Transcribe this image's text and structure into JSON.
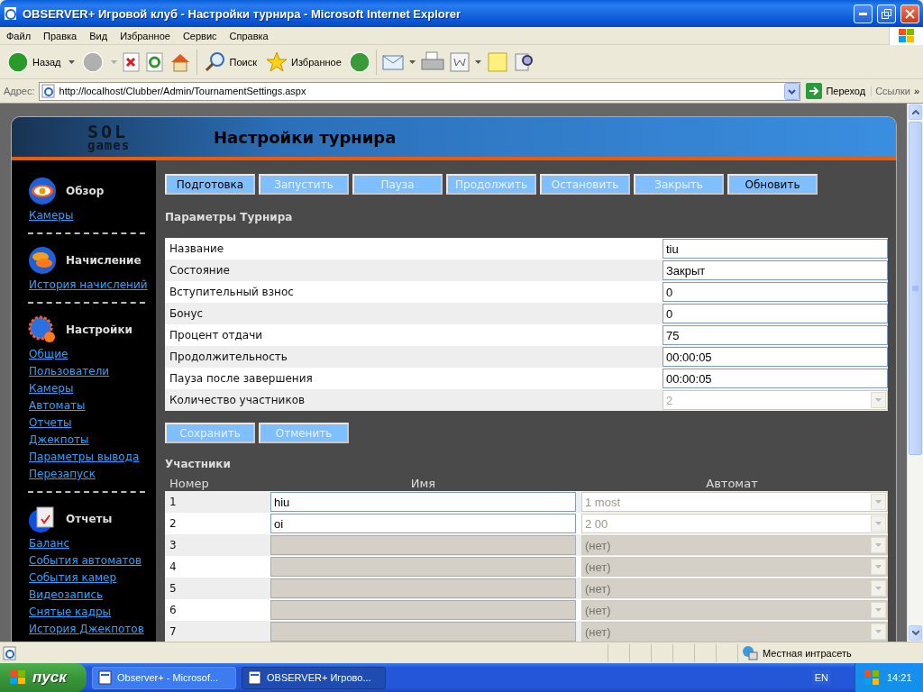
{
  "window": {
    "title": "OBSERVER+ Игровой клуб - Настройки турнира - Microsoft Internet Explorer"
  },
  "menu": [
    "Файл",
    "Правка",
    "Вид",
    "Избранное",
    "Сервис",
    "Справка"
  ],
  "toolbar": {
    "back": "Назад",
    "search": "Поиск",
    "favorites": "Избранное"
  },
  "address": {
    "label": "Адрес:",
    "url": "http://localhost/Clubber/Admin/TournamentSettings.aspx",
    "go": "Переход",
    "links": "Ссылки",
    "more": "»"
  },
  "page": {
    "logo": {
      "top": "SOL",
      "bottom": "games"
    },
    "title": "Настройки турнира",
    "sidebar": [
      {
        "kind": "eye",
        "title": "Обзор",
        "links": [
          "Камеры"
        ]
      },
      {
        "kind": "coins",
        "title": "Начисление",
        "links": [
          "История начислений"
        ]
      },
      {
        "kind": "gears",
        "title": "Настройки",
        "links": [
          "Общие",
          "Пользователи",
          "Камеры",
          "Автоматы",
          "Отчеты",
          "Джекпоты",
          "Параметры вывода",
          "Перезапуск"
        ]
      },
      {
        "kind": "report",
        "title": "Отчеты",
        "links": [
          "Баланс",
          "События автоматов",
          "События камер",
          "Видеозапись",
          "Снятые кадры",
          "История Джекпотов"
        ]
      }
    ],
    "actions": [
      {
        "label": "Подготовка",
        "disabled": false
      },
      {
        "label": "Запустить",
        "disabled": true
      },
      {
        "label": "Пауза",
        "disabled": true
      },
      {
        "label": "Продолжить",
        "disabled": true
      },
      {
        "label": "Остановить",
        "disabled": true
      },
      {
        "label": "Закрыть",
        "disabled": true
      },
      {
        "label": "Обновить",
        "disabled": false
      }
    ],
    "params": {
      "heading": "Параметры Турнира",
      "rows": [
        {
          "kind": "input",
          "label": "Название",
          "value": "tiu",
          "disabled": false
        },
        {
          "kind": "input",
          "label": "Состояние",
          "value": "Закрыт",
          "disabled": false
        },
        {
          "kind": "input",
          "label": "Вступительный взнос",
          "value": "0",
          "disabled": false
        },
        {
          "kind": "input",
          "label": "Бонус",
          "value": "0",
          "disabled": false
        },
        {
          "kind": "input",
          "label": "Процент отдачи",
          "value": "75",
          "disabled": false
        },
        {
          "kind": "input",
          "label": "Продолжительность",
          "value": "00:00:05",
          "disabled": false
        },
        {
          "kind": "input",
          "label": "Пауза после завершения",
          "value": "00:00:05",
          "disabled": false
        },
        {
          "kind": "select",
          "label": "Количество участников",
          "value": "2",
          "disabled": true
        }
      ]
    },
    "form_buttons": [
      {
        "label": "Сохранить",
        "disabled": true
      },
      {
        "label": "Отменить",
        "disabled": true
      }
    ],
    "participants": {
      "heading": "Участники",
      "columns": [
        "Номер",
        "Имя",
        "Автомат"
      ],
      "rows": [
        {
          "number": "1",
          "name": "hiu",
          "machine": "1 most",
          "disabled": false
        },
        {
          "number": "2",
          "name": "oi",
          "machine": "2 00",
          "disabled": false
        },
        {
          "number": "3",
          "machine": "(нет)",
          "disabled": true
        },
        {
          "number": "4",
          "machine": "(нет)",
          "disabled": true
        },
        {
          "number": "5",
          "machine": "(нет)",
          "disabled": true
        },
        {
          "number": "6",
          "machine": "(нет)",
          "disabled": true
        },
        {
          "number": "7",
          "machine": "(нет)",
          "disabled": true
        }
      ]
    }
  },
  "status_bar": {
    "zone": "Местная интрасеть"
  },
  "taskbar": {
    "start": "пуск",
    "tasks": [
      {
        "label": "Observer+ - Microsof...",
        "selected": false
      },
      {
        "label": "OBSERVER+ Игрово...",
        "selected": true
      }
    ],
    "language": "EN",
    "clock": "14:21"
  }
}
